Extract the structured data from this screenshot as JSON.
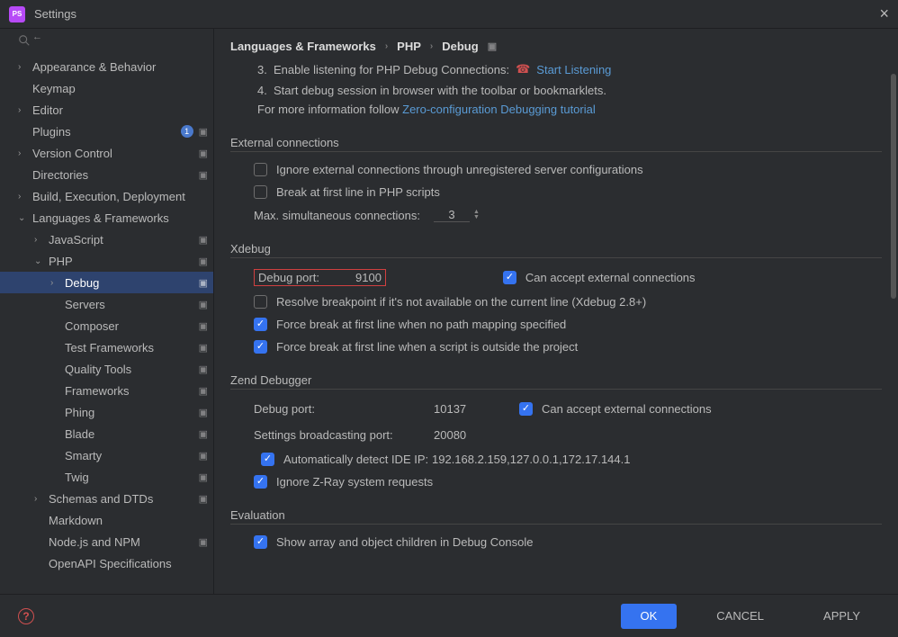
{
  "window": {
    "title": "Settings"
  },
  "sidebar": {
    "items": [
      {
        "label": "Appearance & Behavior",
        "chev": "›",
        "indent": 0
      },
      {
        "label": "Keymap",
        "chev": "",
        "indent": 0
      },
      {
        "label": "Editor",
        "chev": "›",
        "indent": 0
      },
      {
        "label": "Plugins",
        "chev": "",
        "indent": 0,
        "badge": "1",
        "proj": true
      },
      {
        "label": "Version Control",
        "chev": "›",
        "indent": 0,
        "proj": true
      },
      {
        "label": "Directories",
        "chev": "",
        "indent": 0,
        "proj": true
      },
      {
        "label": "Build, Execution, Deployment",
        "chev": "›",
        "indent": 0
      },
      {
        "label": "Languages & Frameworks",
        "chev": "⌄",
        "indent": 0
      },
      {
        "label": "JavaScript",
        "chev": "›",
        "indent": 1,
        "proj": true
      },
      {
        "label": "PHP",
        "chev": "⌄",
        "indent": 1,
        "proj": true
      },
      {
        "label": "Debug",
        "chev": "›",
        "indent": 2,
        "proj": true,
        "selected": true
      },
      {
        "label": "Servers",
        "chev": "",
        "indent": 2,
        "proj": true
      },
      {
        "label": "Composer",
        "chev": "",
        "indent": 2,
        "proj": true
      },
      {
        "label": "Test Frameworks",
        "chev": "",
        "indent": 2,
        "proj": true
      },
      {
        "label": "Quality Tools",
        "chev": "",
        "indent": 2,
        "proj": true
      },
      {
        "label": "Frameworks",
        "chev": "",
        "indent": 2,
        "proj": true
      },
      {
        "label": "Phing",
        "chev": "",
        "indent": 2,
        "proj": true
      },
      {
        "label": "Blade",
        "chev": "",
        "indent": 2,
        "proj": true
      },
      {
        "label": "Smarty",
        "chev": "",
        "indent": 2,
        "proj": true
      },
      {
        "label": "Twig",
        "chev": "",
        "indent": 2,
        "proj": true
      },
      {
        "label": "Schemas and DTDs",
        "chev": "›",
        "indent": 1,
        "proj": true
      },
      {
        "label": "Markdown",
        "chev": "",
        "indent": 1
      },
      {
        "label": "Node.js and NPM",
        "chev": "",
        "indent": 1,
        "proj": true
      },
      {
        "label": "OpenAPI Specifications",
        "chev": "",
        "indent": 1
      }
    ]
  },
  "breadcrumb": {
    "a": "Languages & Frameworks",
    "b": "PHP",
    "c": "Debug"
  },
  "top": {
    "n3": "3.",
    "t3": "Enable listening for PHP Debug Connections:",
    "link3": "Start Listening",
    "n4": "4.",
    "t4": "Start debug session in browser with the toolbar or bookmarklets.",
    "info": "For more information follow",
    "infolink": "Zero-configuration Debugging tutorial"
  },
  "external": {
    "header": "External connections",
    "ignore": "Ignore external connections through unregistered server configurations",
    "break": "Break at first line in PHP scripts",
    "max_label": "Max. simultaneous connections:",
    "max_value": "3"
  },
  "xdebug": {
    "header": "Xdebug",
    "port_label": "Debug port:",
    "port_value": "9100",
    "accept": "Can accept external connections",
    "resolve": "Resolve breakpoint if it's not available on the current line (Xdebug 2.8+)",
    "force1": "Force break at first line when no path mapping specified",
    "force2": "Force break at first line when a script is outside the project"
  },
  "zend": {
    "header": "Zend Debugger",
    "port_label": "Debug port:",
    "port_value": "10137",
    "accept": "Can accept external connections",
    "broadcast_label": "Settings broadcasting port:",
    "broadcast_value": "20080",
    "autodetect": "Automatically detect IDE IP:",
    "ips": "192.168.2.159,127.0.0.1,172.17.144.1",
    "zray": "Ignore Z-Ray system requests"
  },
  "evaluation": {
    "header": "Evaluation",
    "show_array": "Show array and object children in Debug Console"
  },
  "footer": {
    "ok": "OK",
    "cancel": "CANCEL",
    "apply": "APPLY"
  }
}
